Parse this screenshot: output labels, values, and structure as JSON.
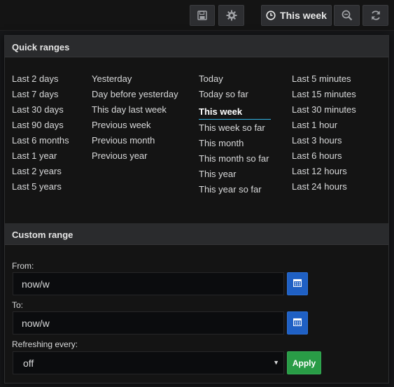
{
  "toolbar": {
    "save_icon": "save-icon",
    "settings_icon": "gear-icon",
    "range_icon": "clock-icon",
    "range_label": "This week",
    "zoom_icon": "zoom-out-icon",
    "refresh_icon": "refresh-icon"
  },
  "quick_ranges": {
    "title": "Quick ranges",
    "columns": [
      [
        "Last 2 days",
        "Last 7 days",
        "Last 30 days",
        "Last 90 days",
        "Last 6 months",
        "Last 1 year",
        "Last 2 years",
        "Last 5 years"
      ],
      [
        "Yesterday",
        "Day before yesterday",
        "This day last week",
        "Previous week",
        "Previous month",
        "Previous year"
      ],
      [
        "Today",
        "Today so far",
        "This week",
        "This week so far",
        "This month",
        "This month so far",
        "This year",
        "This year so far"
      ],
      [
        "Last 5 minutes",
        "Last 15 minutes",
        "Last 30 minutes",
        "Last 1 hour",
        "Last 3 hours",
        "Last 6 hours",
        "Last 12 hours",
        "Last 24 hours"
      ]
    ],
    "active": "This week"
  },
  "custom_range": {
    "title": "Custom range",
    "from_label": "From:",
    "from_value": "now/w",
    "to_label": "To:",
    "to_value": "now/w",
    "refresh_label": "Refreshing every:",
    "refresh_value": "off",
    "apply_label": "Apply"
  },
  "colors": {
    "accent_blue": "#1f60c4",
    "apply_green": "#299c46",
    "active_underline": "#33b5e5"
  }
}
